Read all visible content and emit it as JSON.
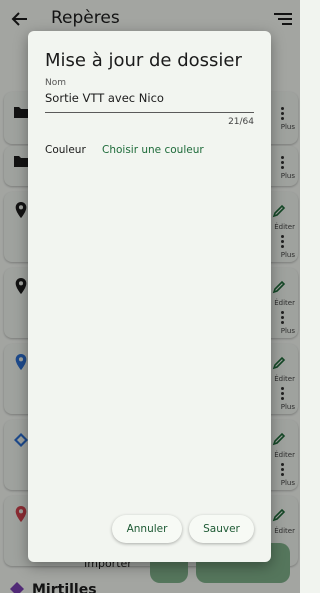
{
  "app": {
    "title": "Repères",
    "fab_import_label": "Importer",
    "bottom_item_title": "Mirtilles",
    "card_more_label": "Plus",
    "card_edit_label": "Éditer"
  },
  "dialog": {
    "title": "Mise à jour de dossier",
    "name_label": "Nom",
    "name_value": "Sortie VTT avec Nico",
    "counter": "21/64",
    "color_label": "Couleur",
    "color_action": "Choisir une couleur",
    "cancel_label": "Annuler",
    "save_label": "Sauver"
  },
  "colors": {
    "accent": "#1e6b3a",
    "fab": "#7fb08a",
    "pin_black": "#1d1d1d",
    "pin_blue": "#2c6fd1",
    "pin_red": "#d0424c"
  }
}
